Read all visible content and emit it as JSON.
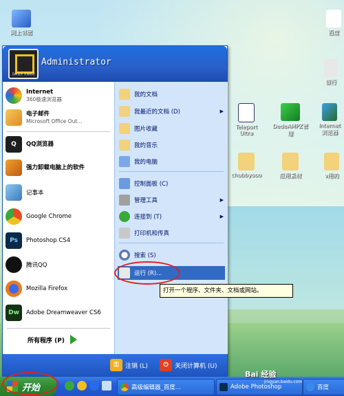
{
  "desktop": {
    "icons": [
      {
        "label": "网上邻居"
      },
      {
        "label": "百度"
      },
      {
        "label": "银行"
      },
      {
        "label": "Teleport Ultra"
      },
      {
        "label": "DedeAMPZ管理"
      },
      {
        "label": "Internet 浏览器"
      },
      {
        "label": "chubbyooo"
      },
      {
        "label": "应用素材"
      },
      {
        "label": "v用的"
      }
    ]
  },
  "start_menu": {
    "user": "Administrator",
    "avatar_text": "日新设计 天南地北",
    "pinned": [
      {
        "title": "Internet",
        "subtitle": "360极速浏览器"
      },
      {
        "title": "电子邮件",
        "subtitle": "Microsoft Office Out..."
      }
    ],
    "recent": [
      {
        "label": "QQ浏览器"
      },
      {
        "label": "强力卸载电脑上的软件"
      },
      {
        "label": "记事本"
      },
      {
        "label": "Google Chrome"
      },
      {
        "label": "Photoshop CS4"
      },
      {
        "label": "腾讯QQ"
      },
      {
        "label": "Mozilla Firefox"
      },
      {
        "label": "Adobe Dreamweaver CS6"
      }
    ],
    "all_programs": "所有程序 (P)",
    "right_items": [
      {
        "label": "我的文档"
      },
      {
        "label": "我最近的文档 (D)"
      },
      {
        "label": "图片收藏"
      },
      {
        "label": "我的音乐"
      },
      {
        "label": "我的电脑"
      },
      {
        "label": "控制面板 (C)"
      },
      {
        "label": "管理工具"
      },
      {
        "label": "连接到 (T)"
      },
      {
        "label": "打印机和传真"
      },
      {
        "label": "搜索 (S)"
      },
      {
        "label": "运行 (R)..."
      }
    ],
    "logoff": "注销 (L)",
    "shutdown": "关闭计算机 (U)",
    "tooltip": "打开一个程序、文件夹、文档或网站。"
  },
  "taskbar": {
    "start_label": "开始",
    "buttons": [
      {
        "label": "高级编辑器_百度..."
      },
      {
        "label": "Adobe Photoshop"
      },
      {
        "label": "百度"
      }
    ]
  },
  "watermark": {
    "brand": "Bai 经验",
    "url": "jingyan.baidu.com"
  }
}
